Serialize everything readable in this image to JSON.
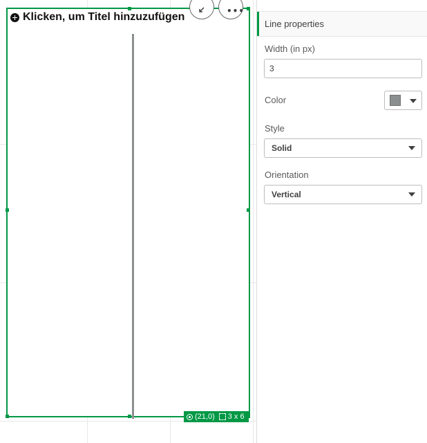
{
  "sheet_object": {
    "title_placeholder": "Klicken, um Titel hinzuzufügen",
    "position_readout": "(21,0)",
    "size_readout": "3 x 6",
    "line_color": "#8c8f8f",
    "selection_color": "#009845"
  },
  "fab": {
    "more_label": "•••"
  },
  "properties": {
    "header": "Line properties",
    "width": {
      "label": "Width (in px)",
      "value": "3"
    },
    "color": {
      "label": "Color",
      "value": "#8c8f8f"
    },
    "style": {
      "label": "Style",
      "value": "Solid"
    },
    "orientation": {
      "label": "Orientation",
      "value": "Vertical"
    }
  }
}
